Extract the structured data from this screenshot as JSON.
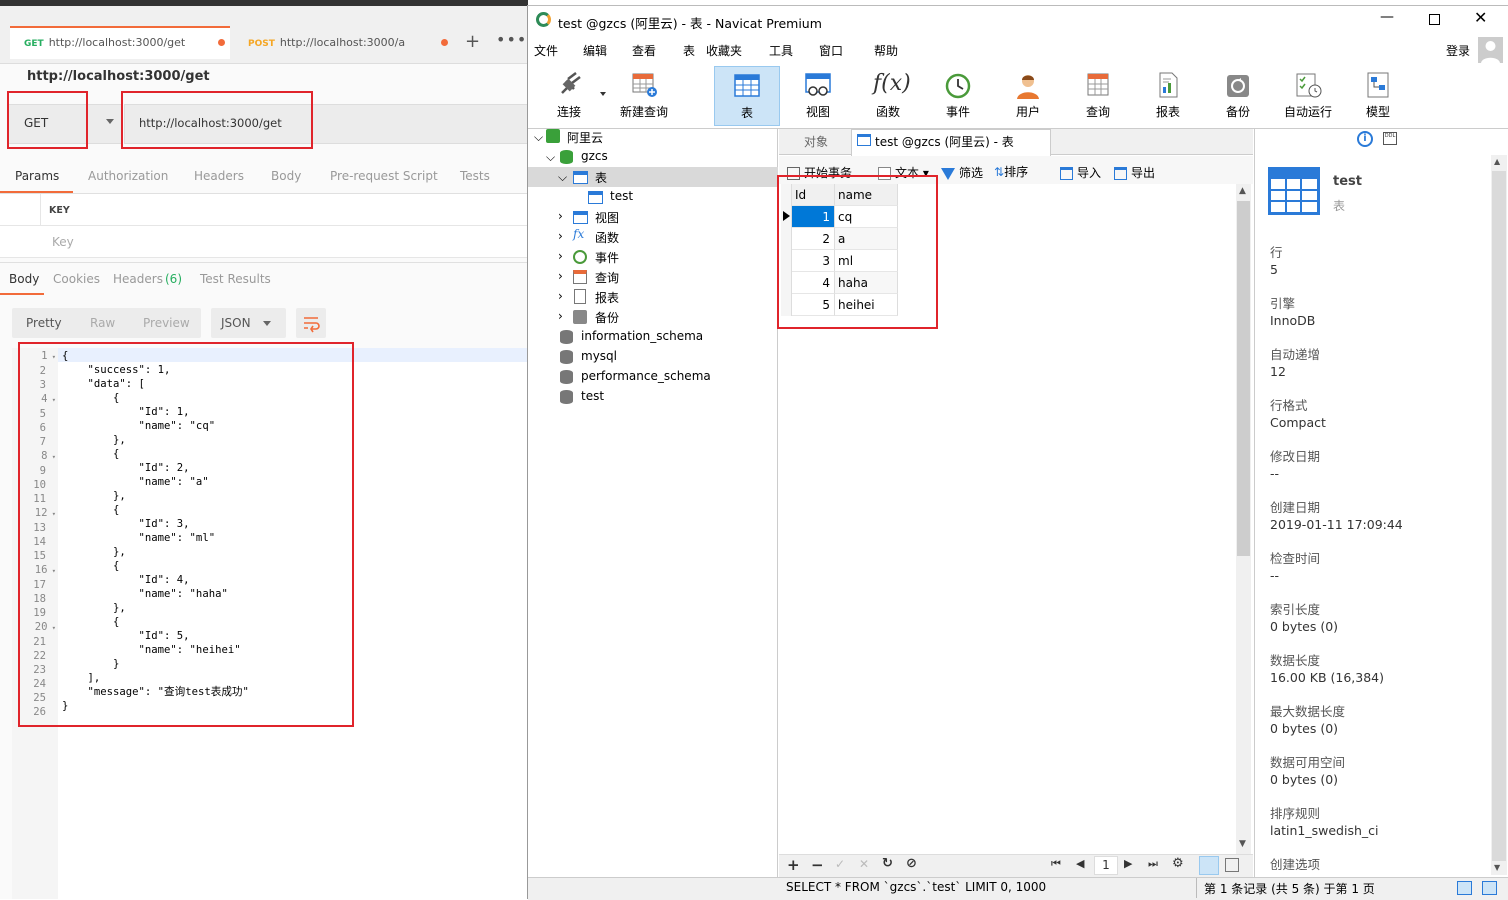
{
  "postman": {
    "tabs": [
      {
        "method": "GET",
        "url": "http://localhost:3000/get"
      },
      {
        "method": "POST",
        "url": "http://localhost:3000/a"
      }
    ],
    "request_title": "http://localhost:3000/get",
    "method": "GET",
    "url": "http://localhost:3000/get",
    "req_tabs": [
      "Params",
      "Authorization",
      "Headers",
      "Body",
      "Pre-request Script",
      "Tests"
    ],
    "params_header": "KEY",
    "key_placeholder": "Key",
    "resp_tabs": [
      "Body",
      "Cookies",
      "Headers",
      "(6)",
      "Test Results"
    ],
    "view_modes": [
      "Pretty",
      "Raw",
      "Preview"
    ],
    "format": "JSON",
    "line_numbers": [
      "1",
      "2",
      "3",
      "4",
      "5",
      "6",
      "7",
      "8",
      "9",
      "10",
      "11",
      "12",
      "13",
      "14",
      "15",
      "16",
      "17",
      "18",
      "19",
      "20",
      "21",
      "22",
      "23",
      "24",
      "25",
      "26"
    ],
    "code_lines": [
      "{",
      "    \"success\": 1,",
      "    \"data\": [",
      "        {",
      "            \"Id\": 1,",
      "            \"name\": \"cq\"",
      "        },",
      "        {",
      "            \"Id\": 2,",
      "            \"name\": \"a\"",
      "        },",
      "        {",
      "            \"Id\": 3,",
      "            \"name\": \"ml\"",
      "        },",
      "        {",
      "            \"Id\": 4,",
      "            \"name\": \"haha\"",
      "        },",
      "        {",
      "            \"Id\": 5,",
      "            \"name\": \"heihei\"",
      "        }",
      "    ],",
      "    \"message\": \"查询test表成功\"",
      "}"
    ]
  },
  "navicat": {
    "title": "test @gzcs (阿里云) - 表 - Navicat Premium",
    "menu": [
      "文件",
      "编辑",
      "查看",
      "表",
      "收藏夹",
      "工具",
      "窗口",
      "帮助"
    ],
    "login": "登录",
    "toolbar": [
      "连接",
      "新建查询",
      "表",
      "视图",
      "函数",
      "事件",
      "用户",
      "查询",
      "报表",
      "备份",
      "自动运行",
      "模型"
    ],
    "tree": {
      "conn": "阿里云",
      "db": "gzcs",
      "tables": "表",
      "table_item": "test",
      "views": "视图",
      "funcs": "函数",
      "events": "事件",
      "queries": "查询",
      "reports": "报表",
      "backups": "备份",
      "other_dbs": [
        "information_schema",
        "mysql",
        "performance_schema",
        "test"
      ]
    },
    "doc_tabs": [
      "对象",
      "test @gzcs (阿里云) - 表"
    ],
    "grid_toolbar": [
      "开始事务",
      "文本",
      "筛选",
      "排序",
      "导入",
      "导出"
    ],
    "columns": [
      "Id",
      "name"
    ],
    "rows": [
      [
        "1",
        "cq"
      ],
      [
        "2",
        "a"
      ],
      [
        "3",
        "ml"
      ],
      [
        "4",
        "haha"
      ],
      [
        "5",
        "heihei"
      ]
    ],
    "page": "1",
    "sql": "SELECT * FROM `gzcs`.`test` LIMIT 0, 1000",
    "status": "第 1 条记录 (共 5 条) 于第 1 页",
    "info": {
      "name": "test",
      "type": "表",
      "props": [
        [
          "行",
          "5"
        ],
        [
          "引擎",
          "InnoDB"
        ],
        [
          "自动递增",
          "12"
        ],
        [
          "行格式",
          "Compact"
        ],
        [
          "修改日期",
          "--"
        ],
        [
          "创建日期",
          "2019-01-11 17:09:44"
        ],
        [
          "检查时间",
          "--"
        ],
        [
          "索引长度",
          "0 bytes (0)"
        ],
        [
          "数据长度",
          "16.00 KB (16,384)"
        ],
        [
          "最大数据长度",
          "0 bytes (0)"
        ],
        [
          "数据可用空间",
          "0 bytes (0)"
        ],
        [
          "排序规则",
          "latin1_swedish_ci"
        ],
        [
          "创建选项",
          ""
        ]
      ]
    }
  },
  "colors": {
    "accent_red": "#e0242b",
    "selection_blue": "#0078d7",
    "postman_orange": "#f26b3a",
    "get_green": "#27ae60"
  }
}
